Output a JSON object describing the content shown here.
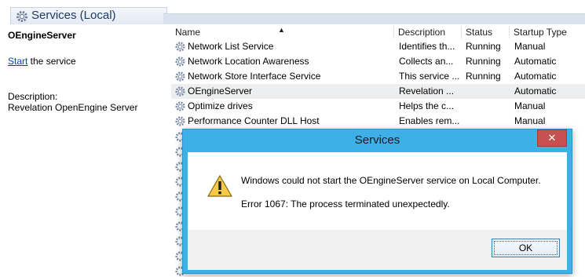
{
  "header": {
    "title": "Services (Local)"
  },
  "left_pane": {
    "service_name": "OEngineServer",
    "start_link": "Start",
    "start_suffix": " the service",
    "description_label": "Description:",
    "description_value": "Revelation OpenEngine Server"
  },
  "table": {
    "columns": [
      "Name",
      "Description",
      "Status",
      "Startup Type"
    ],
    "rows": [
      {
        "name": "Network List Service",
        "description": "Identifies th...",
        "status": "Running",
        "startup": "Manual"
      },
      {
        "name": "Network Location Awareness",
        "description": "Collects an...",
        "status": "Running",
        "startup": "Automatic"
      },
      {
        "name": "Network Store Interface Service",
        "description": "This service ...",
        "status": "Running",
        "startup": "Automatic"
      },
      {
        "name": "OEngineServer",
        "description": "Revelation ...",
        "status": "",
        "startup": "Automatic"
      },
      {
        "name": "Optimize drives",
        "description": "Helps the c...",
        "status": "",
        "startup": "Manual"
      },
      {
        "name": "Performance Counter DLL Host",
        "description": "Enables rem...",
        "status": "",
        "startup": "Manual"
      }
    ]
  },
  "dialog": {
    "title": "Services",
    "close_label": "✕",
    "message": "Windows could not start the OEngineServer service on Local Computer.",
    "error": "Error 1067: The process terminated unexpectedly.",
    "ok_label": "OK"
  },
  "colors": {
    "dialog_frame": "#3db1e7",
    "close_button": "#c75050",
    "link": "#0645ad",
    "selected_row": "#eceef0"
  },
  "icons": {
    "service": "gear-icon",
    "warning": "warning-icon"
  }
}
